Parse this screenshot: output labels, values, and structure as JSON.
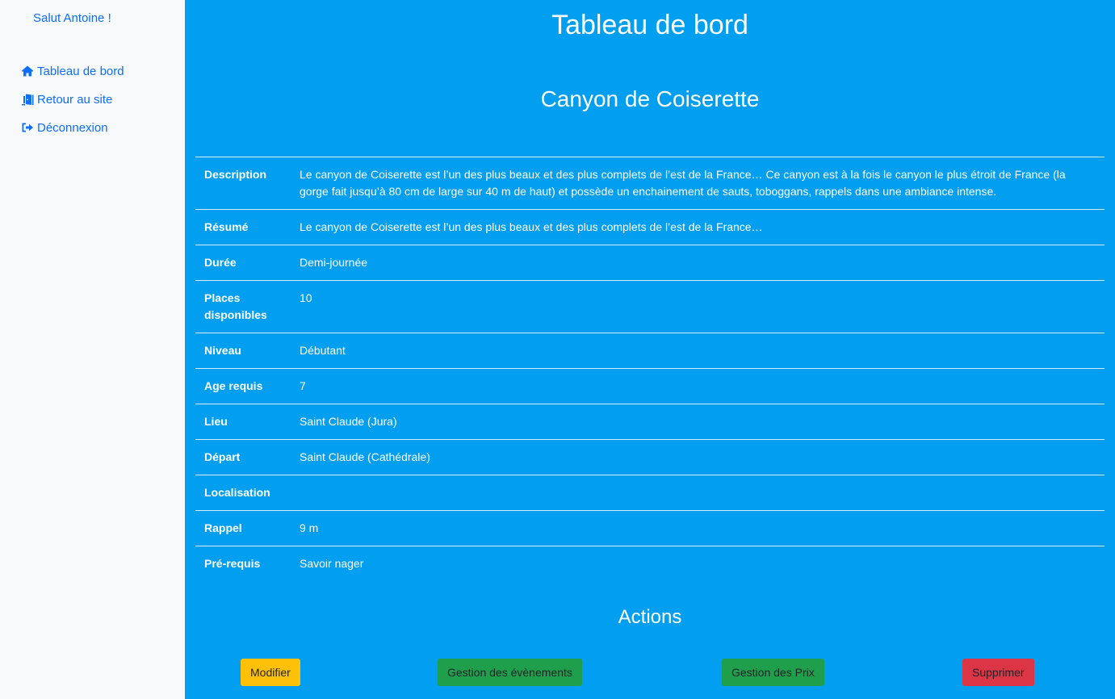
{
  "sidebar": {
    "greeting": "Salut Antoine !",
    "items": [
      {
        "label": "Tableau de bord",
        "icon": "home-icon"
      },
      {
        "label": "Retour au site",
        "icon": "door-exit-icon"
      },
      {
        "label": "Déconnexion",
        "icon": "sign-out-icon"
      }
    ]
  },
  "main": {
    "page_title": "Tableau de bord",
    "item_title": "Canyon de Coiserette",
    "details": [
      {
        "label": "Description",
        "value": "Le canyon de Coiserette est l’un des plus beaux et des plus complets de l’est de la France… Ce canyon est à la fois le canyon le plus étroit de France (la gorge fait jusqu’à 80 cm de large sur 40 m de haut) et possède un enchainement de sauts, toboggans, rappels dans une ambiance intense."
      },
      {
        "label": "Résumé",
        "value": "Le canyon de Coiserette est l’un des plus beaux et des plus complets de l’est de la France…"
      },
      {
        "label": "Durée",
        "value": "Demi-journée"
      },
      {
        "label": "Places disponibles",
        "value": "10"
      },
      {
        "label": "Niveau",
        "value": "Débutant"
      },
      {
        "label": "Age requis",
        "value": "7"
      },
      {
        "label": "Lieu",
        "value": "Saint Claude (Jura)"
      },
      {
        "label": "Départ",
        "value": "Saint Claude (Cathédrale)"
      },
      {
        "label": "Localisation",
        "value": ""
      },
      {
        "label": "Rappel",
        "value": "9 m"
      },
      {
        "label": "Pré-requis",
        "value": "Savoir nager"
      }
    ],
    "actions_title": "Actions",
    "actions": {
      "modifier": "Modifier",
      "events": "Gestion des évènements",
      "prix": "Gestion des Prix",
      "supprimer": "Supprimer"
    }
  },
  "colors": {
    "main_background": "#029ff0",
    "link": "#0d6efd",
    "warning": "#ffc107",
    "success": "#1f9e4c",
    "danger": "#dc3545"
  }
}
